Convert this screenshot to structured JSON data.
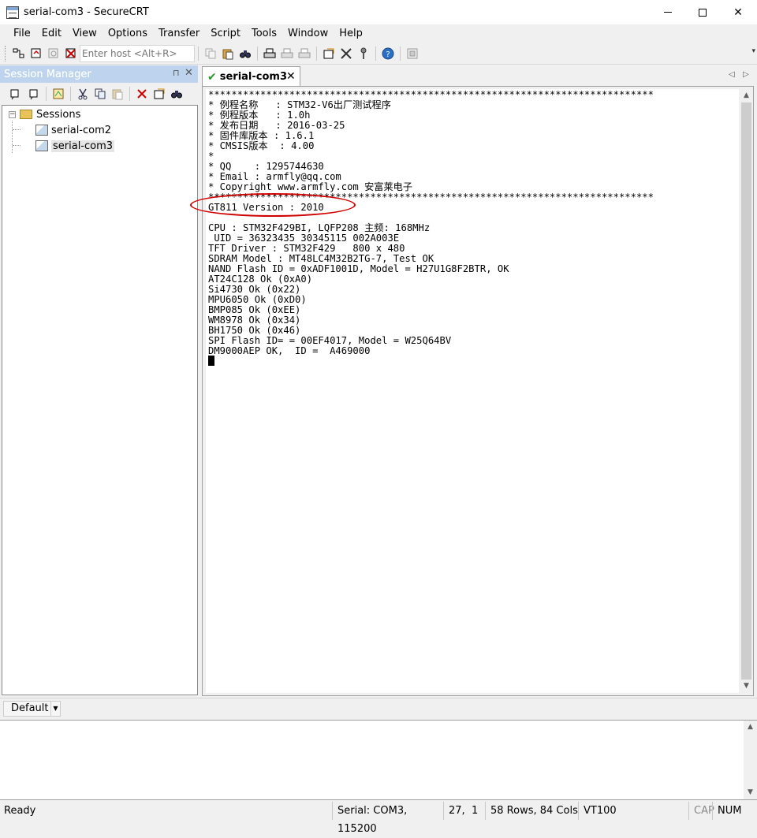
{
  "window": {
    "title": "serial-com3 - SecureCRT",
    "controls": {
      "minimize": "minimize",
      "maximize": "maximize",
      "close": "✕"
    }
  },
  "menu": [
    "File",
    "Edit",
    "View",
    "Options",
    "Transfer",
    "Script",
    "Tools",
    "Window",
    "Help"
  ],
  "toolbar": {
    "host_placeholder": "Enter host <Alt+R>",
    "icons": [
      "connect-icon",
      "quick-connect-icon",
      "reconnect-icon",
      "disconnect-icon",
      "copy-icon",
      "paste-icon",
      "find-icon",
      "print-icon",
      "print-setup-icon",
      "print-selection-icon",
      "session-options-icon",
      "global-options-icon",
      "key-icon",
      "help-icon",
      "keymap-icon"
    ]
  },
  "session_manager": {
    "title": "Session Manager",
    "pin": "⊓",
    "close": "✕",
    "tree": {
      "root": "Sessions",
      "items": [
        "serial-com2",
        "serial-com3"
      ],
      "selected": "serial-com3"
    }
  },
  "tab": {
    "label": "serial-com3",
    "close": "✕",
    "prev": "◁",
    "next": "▷"
  },
  "terminal": {
    "lines": [
      "*****************************************************************************",
      "* 例程名称   : STM32-V6出厂测试程序",
      "* 例程版本   : 1.0h",
      "* 发布日期   : 2016-03-25",
      "* 固件库版本 : 1.6.1",
      "* CMSIS版本  : 4.00",
      "*",
      "* QQ    : 1295744630",
      "* Email : armfly@qq.com",
      "* Copyright www.armfly.com 安富莱电子",
      "*****************************************************************************",
      "GT811 Version : 2010",
      "",
      "CPU : STM32F429BI, LQFP208 主频: 168MHz",
      " UID = 36323435 30345115 002A003E",
      "TFT Driver : STM32F429   800 x 480",
      "SDRAM Model : MT48LC4M32B2TG-7, Test OK",
      "NAND Flash ID = 0xADF1001D, Model = H27U1G8F2BTR, OK",
      "AT24C128 Ok (0xA0)",
      "Si4730 Ok (0x22)",
      "MPU6050 Ok (0xD0)",
      "BMP085 Ok (0xEE)",
      "WM8978 Ok (0x34)",
      "BH1750 Ok (0x46)",
      "SPI Flash ID= = 00EF4017, Model = W25Q64BV",
      "DM9000AEP OK,  ID =  A469000"
    ]
  },
  "command_window": {
    "session_select": "Default"
  },
  "statusbar": {
    "ready": "Ready",
    "connection": "Serial: COM3, 115200",
    "row": "27,",
    "col": "1",
    "size": "58 Rows, 84 Cols",
    "emulation": "VT100",
    "cap": "CAP",
    "num": "NUM"
  }
}
